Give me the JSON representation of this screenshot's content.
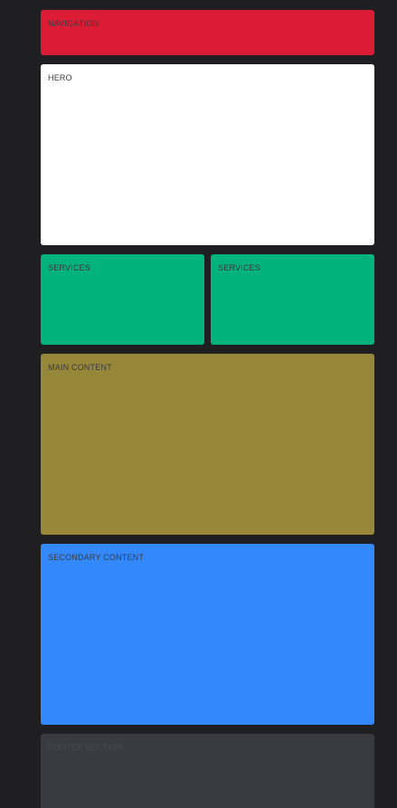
{
  "colors": {
    "background": "#1f1f22",
    "navigation": "#dc1c35",
    "hero": "#ffffff",
    "services": "#00b37a",
    "main_content": "#978839",
    "secondary_content": "#3388fc",
    "footer": "#3a3b40",
    "label_text": "#3a3b40",
    "footer_label_text": "#4a4b50"
  },
  "sections": {
    "navigation": {
      "label": "NAVIGATION"
    },
    "hero": {
      "label": "HERO"
    },
    "services": [
      {
        "label": "SERVICES"
      },
      {
        "label": "SERVICES"
      }
    ],
    "main_content": {
      "label": "MAIN CONTENT"
    },
    "secondary_content": {
      "label": "SECONDARY CONTENT"
    },
    "footer": {
      "label": "FOOTER SECTION"
    }
  }
}
